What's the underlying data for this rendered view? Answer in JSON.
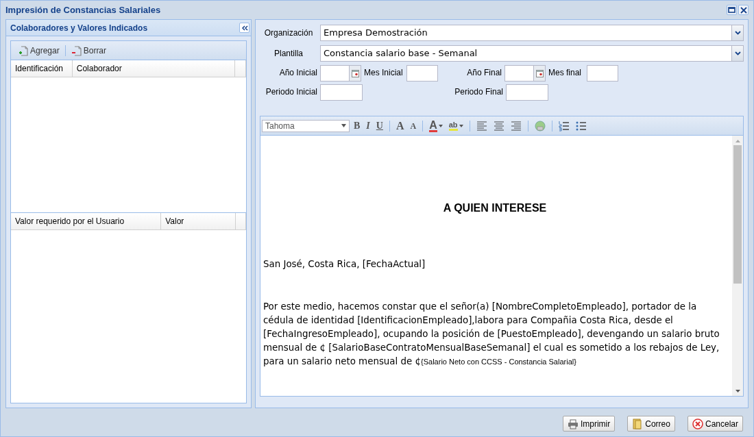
{
  "window": {
    "title": "Impresión de Constancias Salariales"
  },
  "left_panel": {
    "title": "Colaboradores y Valores Indicados",
    "toolbar": [
      {
        "kind": "add",
        "label": "Agregar"
      },
      {
        "kind": "remove",
        "label": "Borrar"
      }
    ],
    "collaborators_table": {
      "columns": [
        "Identificación",
        "Colaborador"
      ]
    },
    "values_table": {
      "columns": [
        "Valor requerido por el Usuario",
        "Valor"
      ]
    }
  },
  "form": {
    "organization": {
      "label": "Organización",
      "value": "Empresa Demostración"
    },
    "template": {
      "label": "Plantilla",
      "value": "Constancia salario base - Semanal"
    },
    "start_year": {
      "label": "Año Inicial"
    },
    "start_month": {
      "label": "Mes Inicial"
    },
    "end_year": {
      "label": "Año Final"
    },
    "end_month": {
      "label": "Mes final"
    },
    "start_period": {
      "label": "Periodo Inicial"
    },
    "end_period": {
      "label": "Periodo Final"
    }
  },
  "editor": {
    "font": "Tahoma",
    "tools": [
      {
        "kind": "bold",
        "glyph": "B"
      },
      {
        "kind": "italic",
        "glyph": "I"
      },
      {
        "kind": "underline",
        "glyph": "U"
      },
      {
        "kind": "sep"
      },
      {
        "kind": "grow",
        "glyph": "A"
      },
      {
        "kind": "shrink",
        "glyph": "A"
      },
      {
        "kind": "sep"
      },
      {
        "kind": "fontcolor",
        "glyph": "A"
      },
      {
        "kind": "highlight",
        "glyph": "ab"
      },
      {
        "kind": "sep"
      },
      {
        "kind": "alignleft"
      },
      {
        "kind": "aligncenter"
      },
      {
        "kind": "alignright"
      },
      {
        "kind": "sep"
      },
      {
        "kind": "image"
      },
      {
        "kind": "sep"
      },
      {
        "kind": "ol"
      },
      {
        "kind": "ul"
      }
    ],
    "heading": "A QUIEN INTERESE",
    "place_line": "San José, Costa Rica, [FechaActual]",
    "body": "Por este medio, hacemos constar que el señor(a) [NombreCompletoEmpleado], portador de la cédula de identidad [IdentificacionEmpleado],labora para Compañia Costa Rica, desde el  [FechaIngresoEmpleado], ocupando la posición de [PuestoEmpleado], devengando un salario bruto mensual de ¢ [SalarioBaseContratoMensualBaseSemanal] el cual es sometido a los rebajos de Ley, para un salario neto mensual de ¢",
    "body_tail": "{Salario Neto con CCSS - Constancia Salarial}"
  },
  "buttons": [
    {
      "kind": "print",
      "label": "Imprimir"
    },
    {
      "kind": "mail",
      "label": "Correo"
    },
    {
      "kind": "cancel",
      "label": "Cancelar"
    }
  ]
}
